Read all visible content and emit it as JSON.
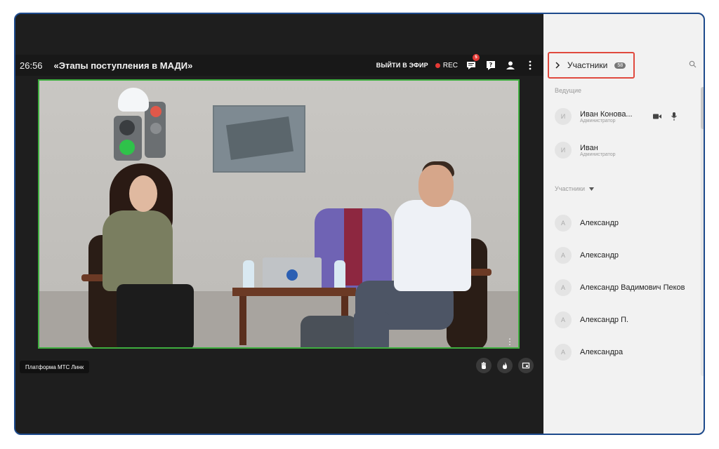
{
  "topbar": {
    "timer": "26:56",
    "title": "«Этапы поступления в МАДИ»",
    "go_live": "ВЫЙТИ В ЭФИР",
    "rec": "REC",
    "chat_badge": "5",
    "icons": [
      "chat-icon",
      "question-icon",
      "person-icon",
      "more-vertical-icon"
    ]
  },
  "video": {
    "platform_tag": "Платформа МТС Линк"
  },
  "controls": [
    "raise-hand-icon",
    "fire-icon",
    "screen-icon"
  ],
  "sidebar": {
    "title": "Участники",
    "count": "58",
    "hosts_label": "Ведущие",
    "participants_label": "Участники",
    "hosts": [
      {
        "initial": "И",
        "name": "Иван Конова...",
        "role": "Администратор"
      },
      {
        "initial": "И",
        "name": "Иван",
        "role": "Администратор"
      }
    ],
    "participants": [
      {
        "initial": "А",
        "name": "Александр"
      },
      {
        "initial": "А",
        "name": "Александр"
      },
      {
        "initial": "А",
        "name": "Александр Вадимович Пеков"
      },
      {
        "initial": "А",
        "name": "Александр П."
      },
      {
        "initial": "А",
        "name": "Александра"
      }
    ]
  },
  "colors": {
    "frame_border": "#1d4a8c",
    "highlight": "#e0493e",
    "speaker_border": "#3fae3f",
    "rec_dot": "#e53935"
  }
}
